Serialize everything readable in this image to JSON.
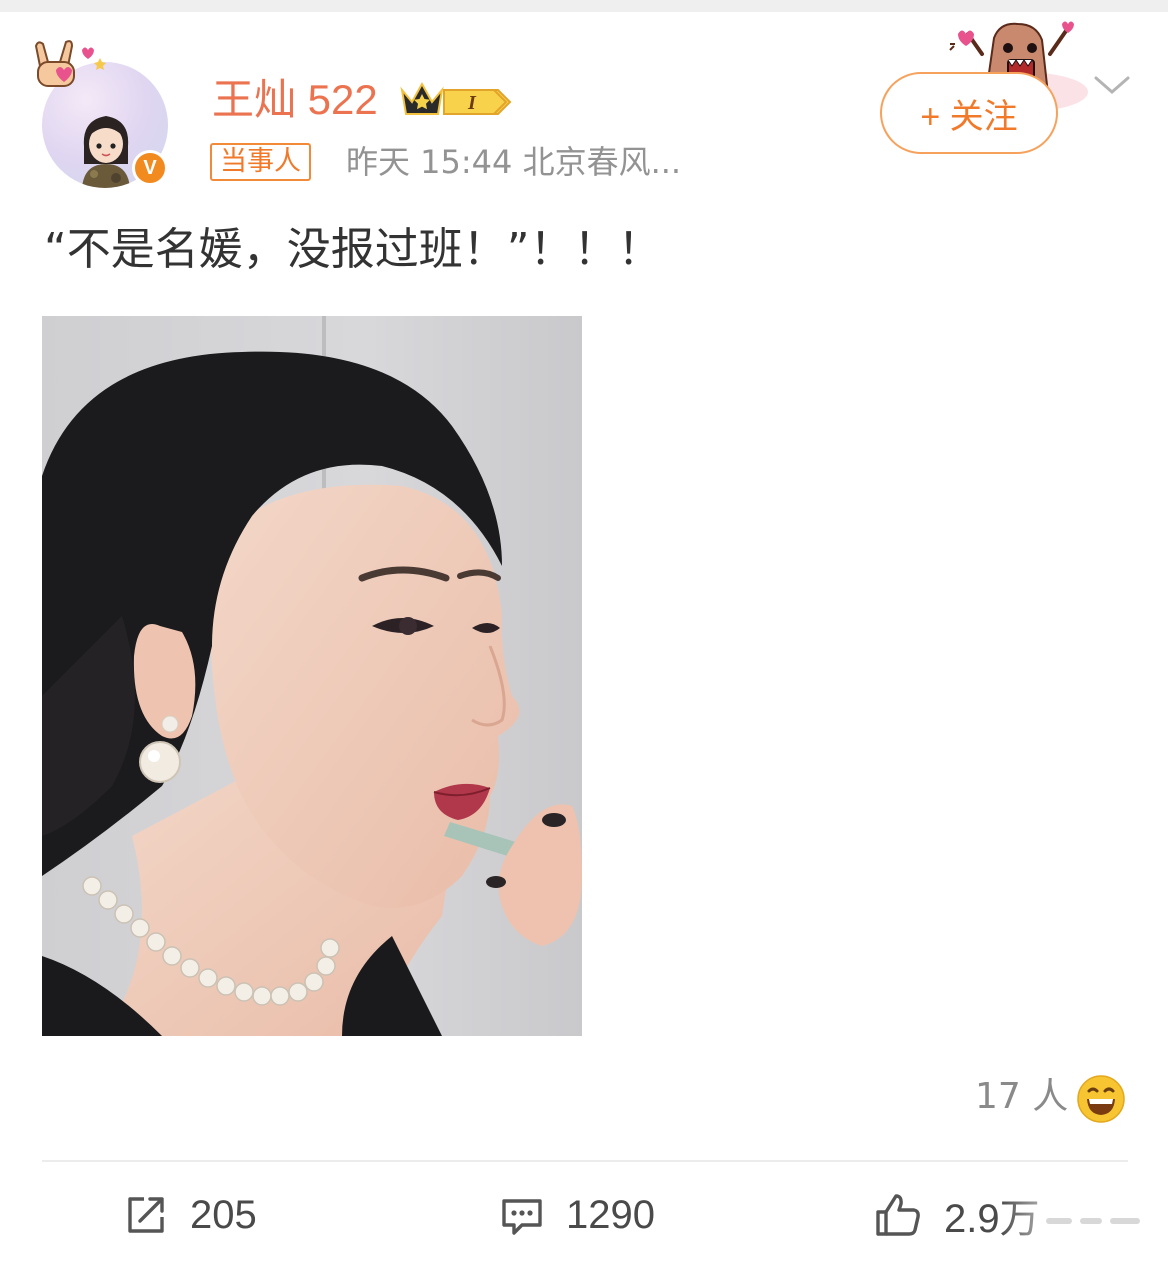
{
  "post": {
    "author": {
      "name": "王灿 522",
      "tag": "当事人",
      "vip_level": "I"
    },
    "meta": "昨天 15:44  北京春风...",
    "follow_label": "+ 关注",
    "text": "“不是名媛，没报过班！”！！！",
    "image": {
      "description_icon": "photo"
    },
    "reactions": {
      "count_label": "17 人",
      "emoji": "grinning-face-icon"
    },
    "actions": {
      "share_count": "205",
      "comment_count": "1290",
      "like_count": "2.9万"
    }
  },
  "colors": {
    "brand_orange": "#eb7350",
    "follow_border": "#f7a25c",
    "muted_text": "#939393",
    "badge_orange": "#f18b1f"
  }
}
